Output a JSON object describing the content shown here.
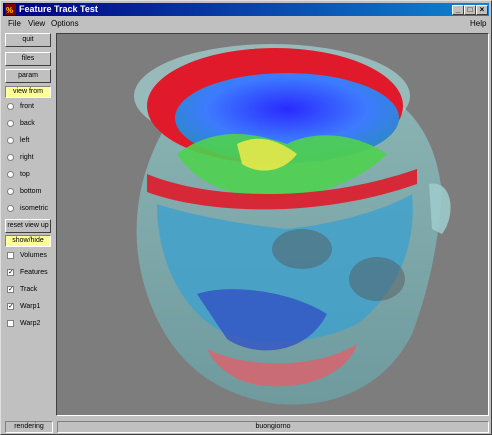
{
  "window": {
    "title": "Feature Track Test"
  },
  "title_buttons": {
    "minimize": "_",
    "maximize": "□",
    "close": "×"
  },
  "menubar": {
    "file": "File",
    "view": "View",
    "options": "Options",
    "help": "Help"
  },
  "sidebar": {
    "quit": "quit",
    "files": "files",
    "param": "param",
    "view_from_label": "view from",
    "views": [
      "front",
      "back",
      "left",
      "right",
      "top",
      "bottom",
      "isometric"
    ],
    "reset": "reset view up",
    "showhide_label": "show/hide",
    "layers": [
      {
        "label": "Volumes",
        "checked": false
      },
      {
        "label": "Features",
        "checked": true
      },
      {
        "label": "Track",
        "checked": true
      },
      {
        "label": "Warp1",
        "checked": true
      },
      {
        "label": "Warp2",
        "checked": false
      }
    ]
  },
  "status": {
    "left": "rendering",
    "right": "buongiorno"
  },
  "colors": {
    "titlebar": "#000080",
    "highlight": "#ffff99",
    "viewport_bg": "#7d7d7d"
  }
}
